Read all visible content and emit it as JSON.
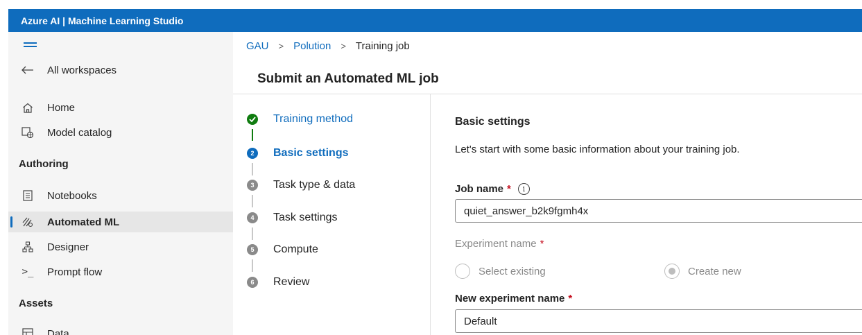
{
  "app": {
    "title": "Azure AI | Machine Learning Studio"
  },
  "sidebar": {
    "back_label": "All workspaces",
    "home_label": "Home",
    "model_catalog_label": "Model catalog",
    "section_authoring": "Authoring",
    "notebooks_label": "Notebooks",
    "automated_ml_label": "Automated ML",
    "designer_label": "Designer",
    "prompt_flow_label": "Prompt flow",
    "section_assets": "Assets",
    "data_label": "Data"
  },
  "breadcrumb": {
    "items": [
      "GAU",
      "Polution",
      "Training job"
    ],
    "separator": ">"
  },
  "page": {
    "title": "Submit an Automated ML job"
  },
  "wizard": {
    "steps": [
      {
        "number": "✓",
        "label": "Training method",
        "state": "done"
      },
      {
        "number": "2",
        "label": "Basic settings",
        "state": "active"
      },
      {
        "number": "3",
        "label": "Task type & data",
        "state": "pending"
      },
      {
        "number": "4",
        "label": "Task settings",
        "state": "pending"
      },
      {
        "number": "5",
        "label": "Compute",
        "state": "pending"
      },
      {
        "number": "6",
        "label": "Review",
        "state": "pending"
      }
    ]
  },
  "form": {
    "heading": "Basic settings",
    "description": "Let's start with some basic information about your training job.",
    "job_name_label": "Job name",
    "job_name_value": "quiet_answer_b2k9fgmh4x",
    "required_marker": "*",
    "info_glyph": "i",
    "experiment_name_label": "Experiment name",
    "radio_select_existing": "Select existing",
    "radio_create_new": "Create new",
    "new_experiment_name_label": "New experiment name",
    "new_experiment_name_value": "Default"
  },
  "colors": {
    "accent": "#0f6cbd",
    "success": "#107c10",
    "required": "#c50f1f"
  }
}
